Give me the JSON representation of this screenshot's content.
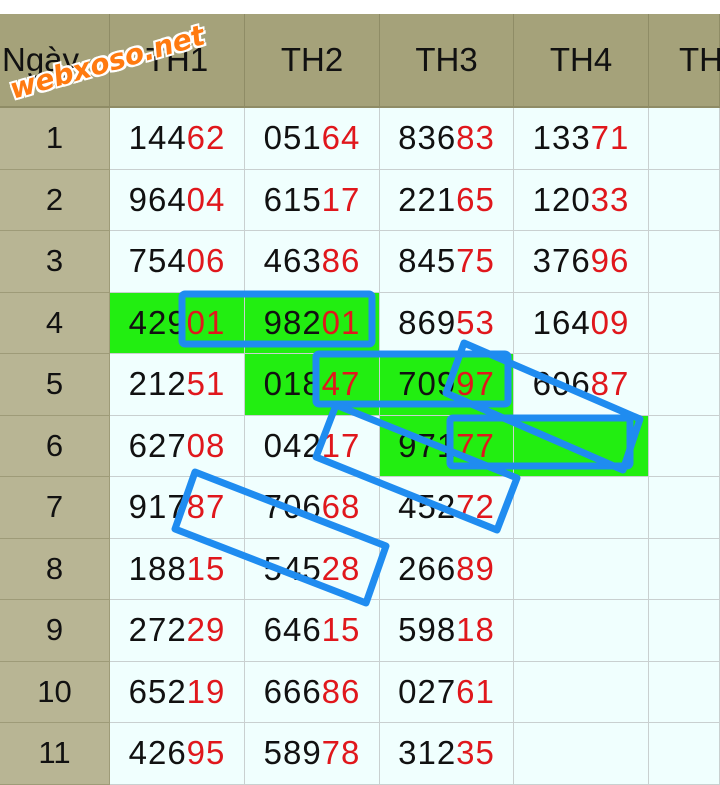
{
  "watermark": "webxoso.net",
  "header": {
    "day_label": "Ngày",
    "columns": [
      "TH1",
      "TH2",
      "TH3",
      "TH4",
      "TH"
    ]
  },
  "rows": [
    {
      "day": "1",
      "cells": [
        [
          "144",
          "62"
        ],
        [
          "051",
          "64"
        ],
        [
          "836",
          "83"
        ],
        [
          "133",
          "71"
        ],
        null
      ]
    },
    {
      "day": "2",
      "cells": [
        [
          "964",
          "04"
        ],
        [
          "615",
          "17"
        ],
        [
          "221",
          "65"
        ],
        [
          "120",
          "33"
        ],
        null
      ]
    },
    {
      "day": "3",
      "cells": [
        [
          "754",
          "06"
        ],
        [
          "463",
          "86"
        ],
        [
          "845",
          "75"
        ],
        [
          "376",
          "96"
        ],
        null
      ]
    },
    {
      "day": "4",
      "cells": [
        [
          "429",
          "01"
        ],
        [
          "982",
          "01"
        ],
        [
          "869",
          "53"
        ],
        [
          "164",
          "09"
        ],
        null
      ]
    },
    {
      "day": "5",
      "cells": [
        [
          "212",
          "51"
        ],
        [
          "018",
          "47"
        ],
        [
          "709",
          "97"
        ],
        [
          "606",
          "87"
        ],
        null
      ]
    },
    {
      "day": "6",
      "cells": [
        [
          "627",
          "08"
        ],
        [
          "042",
          "17"
        ],
        [
          "971",
          "77"
        ],
        [
          "",
          ""
        ],
        null
      ]
    },
    {
      "day": "7",
      "cells": [
        [
          "917",
          "87"
        ],
        [
          "706",
          "68"
        ],
        [
          "452",
          "72"
        ],
        null,
        null
      ]
    },
    {
      "day": "8",
      "cells": [
        [
          "188",
          "15"
        ],
        [
          "545",
          "28"
        ],
        [
          "266",
          "89"
        ],
        null,
        null
      ]
    },
    {
      "day": "9",
      "cells": [
        [
          "272",
          "29"
        ],
        [
          "646",
          "15"
        ],
        [
          "598",
          "18"
        ],
        null,
        null
      ]
    },
    {
      "day": "10",
      "cells": [
        [
          "652",
          "19"
        ],
        [
          "666",
          "86"
        ],
        [
          "027",
          "61"
        ],
        null,
        null
      ]
    },
    {
      "day": "11",
      "cells": [
        [
          "426",
          "95"
        ],
        [
          "589",
          "78"
        ],
        [
          "312",
          "35"
        ],
        null,
        null
      ]
    }
  ],
  "highlighted": [
    [
      3,
      0
    ],
    [
      3,
      1
    ],
    [
      4,
      1
    ],
    [
      4,
      2
    ],
    [
      5,
      2
    ],
    [
      5,
      3
    ]
  ],
  "colors": {
    "highlight": "#22ee11",
    "annotation": "#1f8cf0",
    "tail_digits": "#e0171c"
  }
}
